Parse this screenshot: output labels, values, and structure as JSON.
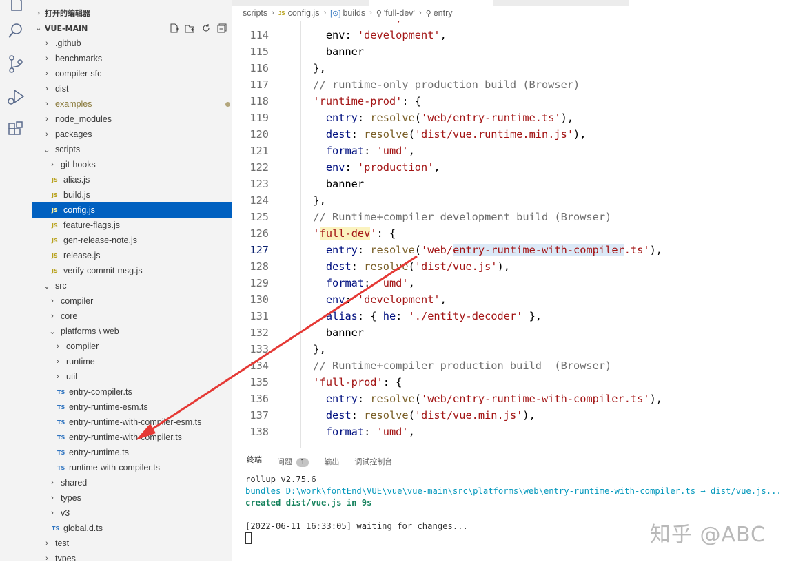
{
  "activity_bar": [
    "explorer-icon",
    "search-icon",
    "source-control-icon",
    "run-debug-icon",
    "extensions-icon"
  ],
  "sidebar": {
    "open_editors_title": "打开的编辑器",
    "project_title": "VUE-MAIN",
    "tree": [
      {
        "label": ".github",
        "twisty": "›",
        "depth": 0
      },
      {
        "label": "benchmarks",
        "twisty": "›",
        "depth": 0
      },
      {
        "label": "compiler-sfc",
        "twisty": "›",
        "depth": 0
      },
      {
        "label": "dist",
        "twisty": "›",
        "depth": 0
      },
      {
        "label": "examples",
        "twisty": "›",
        "depth": 0,
        "modified": true
      },
      {
        "label": "node_modules",
        "twisty": "›",
        "depth": 0
      },
      {
        "label": "packages",
        "twisty": "›",
        "depth": 0
      },
      {
        "label": "scripts",
        "twisty": "⌄",
        "depth": 0
      },
      {
        "label": "git-hooks",
        "twisty": "›",
        "depth": 1
      },
      {
        "label": "alias.js",
        "file": "JS",
        "depth": 1
      },
      {
        "label": "build.js",
        "file": "JS",
        "depth": 1
      },
      {
        "label": "config.js",
        "file": "JS",
        "depth": 1,
        "selected": true
      },
      {
        "label": "feature-flags.js",
        "file": "JS",
        "depth": 1
      },
      {
        "label": "gen-release-note.js",
        "file": "JS",
        "depth": 1
      },
      {
        "label": "release.js",
        "file": "JS",
        "depth": 1
      },
      {
        "label": "verify-commit-msg.js",
        "file": "JS",
        "depth": 1
      },
      {
        "label": "src",
        "twisty": "⌄",
        "depth": 0
      },
      {
        "label": "compiler",
        "twisty": "›",
        "depth": 1
      },
      {
        "label": "core",
        "twisty": "›",
        "depth": 1
      },
      {
        "label": "platforms \\ web",
        "twisty": "⌄",
        "depth": 1
      },
      {
        "label": "compiler",
        "twisty": "›",
        "depth": 2
      },
      {
        "label": "runtime",
        "twisty": "›",
        "depth": 2
      },
      {
        "label": "util",
        "twisty": "›",
        "depth": 2
      },
      {
        "label": "entry-compiler.ts",
        "file": "TS",
        "depth": 2
      },
      {
        "label": "entry-runtime-esm.ts",
        "file": "TS",
        "depth": 2
      },
      {
        "label": "entry-runtime-with-compiler-esm.ts",
        "file": "TS",
        "depth": 2
      },
      {
        "label": "entry-runtime-with-compiler.ts",
        "file": "TS",
        "depth": 2
      },
      {
        "label": "entry-runtime.ts",
        "file": "TS",
        "depth": 2
      },
      {
        "label": "runtime-with-compiler.ts",
        "file": "TS",
        "depth": 2
      },
      {
        "label": "shared",
        "twisty": "›",
        "depth": 1
      },
      {
        "label": "types",
        "twisty": "›",
        "depth": 1
      },
      {
        "label": "v3",
        "twisty": "›",
        "depth": 1
      },
      {
        "label": "global.d.ts",
        "file": "TS",
        "depth": 1
      },
      {
        "label": "test",
        "twisty": "›",
        "depth": 0
      },
      {
        "label": "types",
        "twisty": "›",
        "depth": 0
      }
    ]
  },
  "breadcrumb": {
    "scripts": "scripts",
    "file": "config.js",
    "file_badge": "JS",
    "builds": "builds",
    "full_dev": "'full-dev'",
    "entry": "entry"
  },
  "code": {
    "top_partial": "  format: 'umd',",
    "lines": [
      {
        "n": "114",
        "html": "    env: <span class='s'>'development'</span>,"
      },
      {
        "n": "115",
        "html": "    banner"
      },
      {
        "n": "116",
        "html": "  },"
      },
      {
        "n": "117",
        "html": "  <span class='cm'>// runtime-only production build (Browser)</span>"
      },
      {
        "n": "118",
        "html": "  <span class='s'>'runtime-prod'</span>: {"
      },
      {
        "n": "119",
        "html": "    <span class='kw'>entry</span>: <span class='fn'>resolve</span>(<span class='s'>'web/entry-runtime.ts'</span>),"
      },
      {
        "n": "120",
        "html": "    <span class='kw'>dest</span>: <span class='fn'>resolve</span>(<span class='s'>'dist/vue.runtime.min.js'</span>),"
      },
      {
        "n": "121",
        "html": "    <span class='kw'>format</span>: <span class='s'>'umd'</span>,"
      },
      {
        "n": "122",
        "html": "    <span class='kw'>env</span>: <span class='s'>'production'</span>,"
      },
      {
        "n": "123",
        "html": "    banner"
      },
      {
        "n": "124",
        "html": "  },"
      },
      {
        "n": "125",
        "html": "  <span class='cm'>// Runtime+compiler development build (Browser)</span>"
      },
      {
        "n": "126",
        "html": "  <span class='s'>'<span class='hl-y'>full-dev</span>'</span>: {"
      },
      {
        "n": "127",
        "html": "    <span class='kw'>entry</span>: <span class='fn'>resolve</span>(<span class='s'>'web/<span class='hl-b'>entry-runtime-with-compiler</span>.ts'</span>),",
        "active": true
      },
      {
        "n": "128",
        "html": "    <span class='kw'>dest</span>: <span class='fn'>resolve</span>(<span class='s'>'dist/vue.js'</span>),"
      },
      {
        "n": "129",
        "html": "    <span class='kw'>format</span>: <span class='s'>'umd'</span>,"
      },
      {
        "n": "130",
        "html": "    <span class='kw'>env</span>: <span class='s'>'development'</span>,"
      },
      {
        "n": "131",
        "html": "    <span class='kw'>alias</span>: { <span class='kw'>he</span>: <span class='s'>'./entity-decoder'</span> },"
      },
      {
        "n": "132",
        "html": "    banner"
      },
      {
        "n": "133",
        "html": "  },"
      },
      {
        "n": "134",
        "html": "  <span class='cm'>// Runtime+compiler production build  (Browser)</span>"
      },
      {
        "n": "135",
        "html": "  <span class='s'>'full-prod'</span>: {"
      },
      {
        "n": "136",
        "html": "    <span class='kw'>entry</span>: <span class='fn'>resolve</span>(<span class='s'>'web/entry-runtime-with-compiler.ts'</span>),"
      },
      {
        "n": "137",
        "html": "    <span class='kw'>dest</span>: <span class='fn'>resolve</span>(<span class='s'>'dist/vue.min.js'</span>),"
      },
      {
        "n": "138",
        "html": "    <span class='kw'>format</span>: <span class='s'>'umd'</span>,"
      }
    ]
  },
  "panel": {
    "tabs": [
      "终端",
      "问题",
      "输出",
      "调试控制台"
    ],
    "problems_count": "1",
    "terminal": {
      "line1": "rollup v2.75.6",
      "line2": "bundles D:\\work\\fontEnd\\VUE\\vue\\vue-main\\src\\platforms\\web\\entry-runtime-with-compiler.ts → dist/vue.js...",
      "line3": "created dist/vue.js in 9s",
      "line4": "[2022-06-11 16:33:05] waiting for changes..."
    }
  },
  "watermark": "知乎 @ABC",
  "colors": {
    "selection": "#0060c0",
    "arrow": "#e53935"
  }
}
